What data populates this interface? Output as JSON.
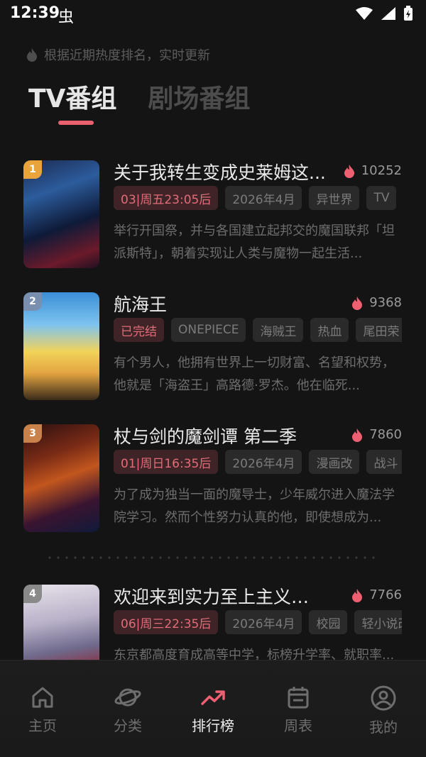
{
  "status": {
    "time": "12:39",
    "bug": "虫"
  },
  "hint": "根据近期热度排名，实时更新",
  "tabs": [
    {
      "label": "TV番组"
    },
    {
      "label": "剧场番组"
    }
  ],
  "items": [
    {
      "rank": "1",
      "rank_color": "#e8a33b",
      "title": "关于我转生变成史莱姆这...",
      "heat": "10252",
      "tags": [
        "03|周五23:05后",
        "2026年4月",
        "异世界",
        "TV",
        ""
      ],
      "desc": "举行开国祭，并与各国建立起邦交的魔国联邦「坦派斯特」，朝着实现让人类与魔物一起生活..."
    },
    {
      "rank": "2",
      "rank_color": "#7a8fb0",
      "title": "航海王",
      "heat": "9368",
      "tags": [
        "已完结",
        "ONEPIECE",
        "海贼王",
        "热血",
        "尾田荣"
      ],
      "desc": "有个男人，他拥有世界上一切财富、名望和权势，他就是「海盗王」高路德·罗杰。他在临死..."
    },
    {
      "rank": "3",
      "rank_color": "#c9824a",
      "title": "杖与剑的魔剑谭 第二季",
      "heat": "7860",
      "tags": [
        "01|周日16:35后",
        "2026年4月",
        "漫画改",
        "战斗"
      ],
      "desc": "为了成为独当一面的魔导士，少年威尔进入魔法学院学习。然而个性努力认真的他，即使想成为..."
    },
    {
      "rank": "4",
      "rank_color": "#8a8a8a",
      "title": "欢迎来到实力至上主义教室...",
      "heat": "7766",
      "tags": [
        "06|周三22:35后",
        "2026年4月",
        "校园",
        "轻小说改"
      ],
      "desc": "东京都高度育成高等中学，标榜升学率、就职率..."
    }
  ],
  "nav": [
    {
      "label": "主页",
      "icon": "home-icon"
    },
    {
      "label": "分类",
      "icon": "planet-icon"
    },
    {
      "label": "排行榜",
      "icon": "trending-icon"
    },
    {
      "label": "周表",
      "icon": "calendar-icon"
    },
    {
      "label": "我的",
      "icon": "user-icon"
    }
  ],
  "colors": {
    "accent": "#e9606e",
    "bg": "#141414"
  }
}
